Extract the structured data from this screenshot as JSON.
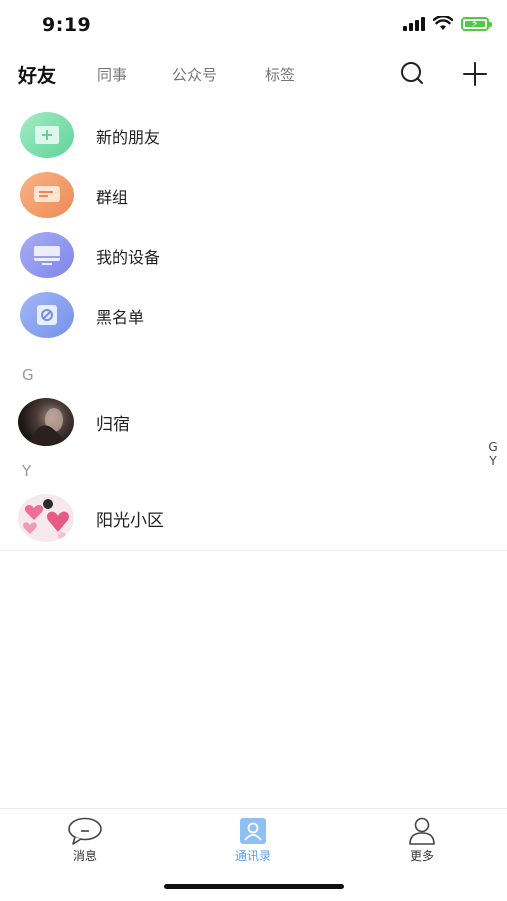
{
  "status_bar": {
    "time": "9:19"
  },
  "top_tabs": [
    {
      "label": "好友",
      "active": true
    },
    {
      "label": "同事",
      "active": false
    },
    {
      "label": "公众号",
      "active": false
    },
    {
      "label": "标签",
      "active": false
    }
  ],
  "top_actions": {
    "search_icon": "search-icon",
    "add_icon": "plus-icon"
  },
  "function_items": [
    {
      "label": "新的朋友",
      "icon": "add-friend-icon",
      "color": "#6fd8a2"
    },
    {
      "label": "群组",
      "icon": "group-chat-icon",
      "color": "#ef9660"
    },
    {
      "label": "我的设备",
      "icon": "monitor-icon",
      "color": "#8c92ee"
    },
    {
      "label": "黑名单",
      "icon": "block-icon",
      "color": "#829cee"
    }
  ],
  "sections": [
    {
      "letter": "G",
      "contacts": [
        {
          "name": "归宿"
        }
      ]
    },
    {
      "letter": "Y",
      "contacts": [
        {
          "name": "阳光小区"
        }
      ]
    }
  ],
  "index_letters": [
    "G",
    "Y"
  ],
  "bottom_nav": [
    {
      "label": "消息",
      "icon": "chat-bubble-icon",
      "active": false
    },
    {
      "label": "通讯录",
      "icon": "contacts-icon",
      "active": true
    },
    {
      "label": "更多",
      "icon": "person-icon",
      "active": false
    }
  ],
  "colors": {
    "accent": "#5aa0f0",
    "battery": "#4ccd3c"
  }
}
